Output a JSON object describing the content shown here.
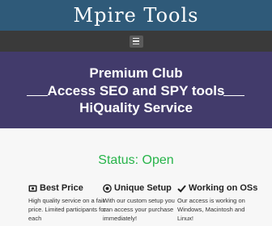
{
  "header": {
    "title": "Mpire Tools"
  },
  "nav": {
    "menu_icon": "hamburger-icon"
  },
  "hero": {
    "line1": "Premium Club",
    "line2": "Access SEO and SPY tools",
    "line3": "HiQuality Service",
    "background": "#423b6b"
  },
  "status": {
    "text": "Status: Open",
    "color": "#27b44a"
  },
  "features": [
    {
      "icon": "price-tag-icon",
      "title": "Best Price",
      "text": "High quality service on a fair price. Limited participants for each"
    },
    {
      "icon": "setup-circle-icon",
      "title": "Unique Setup",
      "text": "With our custom setup you can access your purchase immediately!"
    },
    {
      "icon": "checkmark-icon",
      "title": "Working on OSs",
      "text": "Our access is working on Windows, Macintosh and Linux!"
    }
  ],
  "colors": {
    "header": "#2f5a79",
    "navbar": "#3a3a3a",
    "page": "#f7f7f7"
  }
}
